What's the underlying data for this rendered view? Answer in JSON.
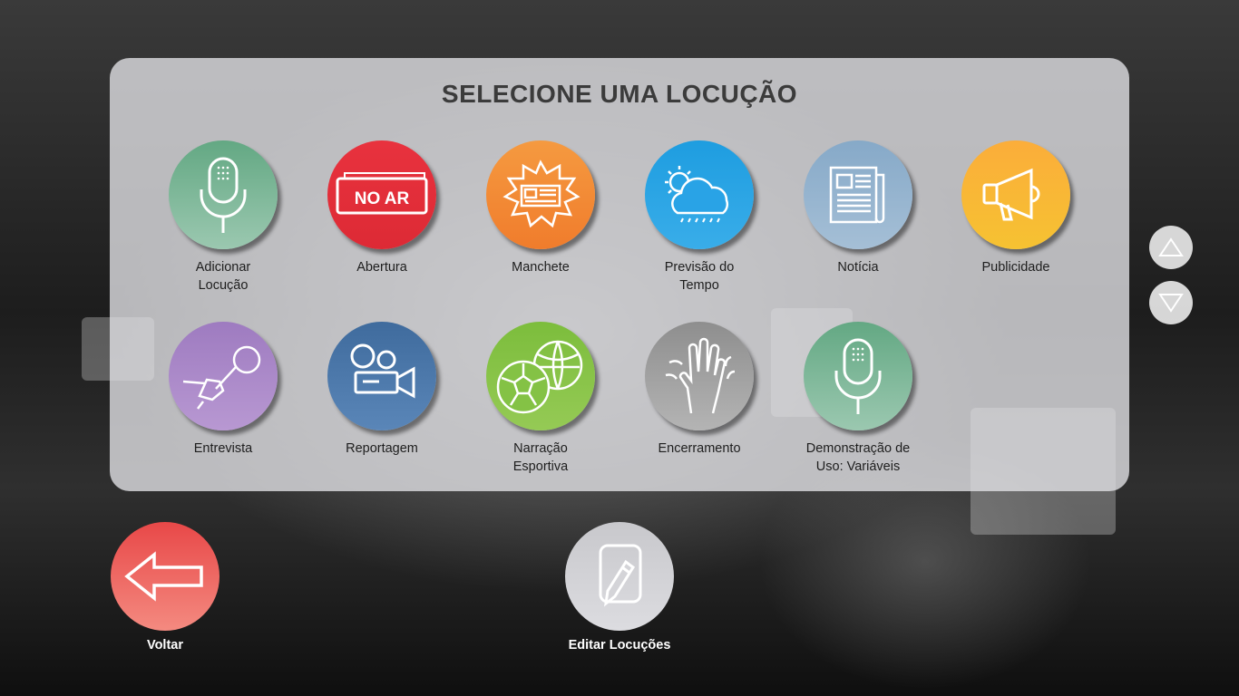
{
  "title": "SELECIONE UMA LOCUÇÃO",
  "tiles": [
    {
      "label": "Adicionar\nLocução",
      "icon": "microphone-icon",
      "color": "#6fb08e"
    },
    {
      "label": "Abertura",
      "icon": "on-air-sign-icon",
      "color": "#e0303b",
      "icon_text": "NO AR"
    },
    {
      "label": "Manchete",
      "icon": "headline-burst-icon",
      "color": "#f28c38"
    },
    {
      "label": "Previsão do\nTempo",
      "icon": "weather-cloud-icon",
      "color": "#2aa4e4"
    },
    {
      "label": "Notícia",
      "icon": "newspaper-icon",
      "color": "#8fb0cc"
    },
    {
      "label": "Publicidade",
      "icon": "megaphone-icon",
      "color": "#f8b934"
    },
    {
      "label": "Entrevista",
      "icon": "interview-mic-icon",
      "color": "#a985c6"
    },
    {
      "label": "Reportagem",
      "icon": "video-camera-icon",
      "color": "#4a76a8"
    },
    {
      "label": "Narração\nEsportiva",
      "icon": "sports-balls-icon",
      "color": "#86c24a"
    },
    {
      "label": "Encerramento",
      "icon": "waving-hand-icon",
      "color": "#a2a2a2"
    },
    {
      "label": "Demonstração de\nUso: Variáveis",
      "icon": "microphone-icon",
      "color": "#6fb08e"
    }
  ],
  "scroll": {
    "up_icon": "triangle-up-icon",
    "down_icon": "triangle-down-icon"
  },
  "back_button": {
    "label": "Voltar",
    "icon": "arrow-left-icon",
    "color": "#ee5a5a"
  },
  "edit_button": {
    "label": "Editar Locuções",
    "icon": "edit-document-icon",
    "color": "#d0d0d4"
  }
}
